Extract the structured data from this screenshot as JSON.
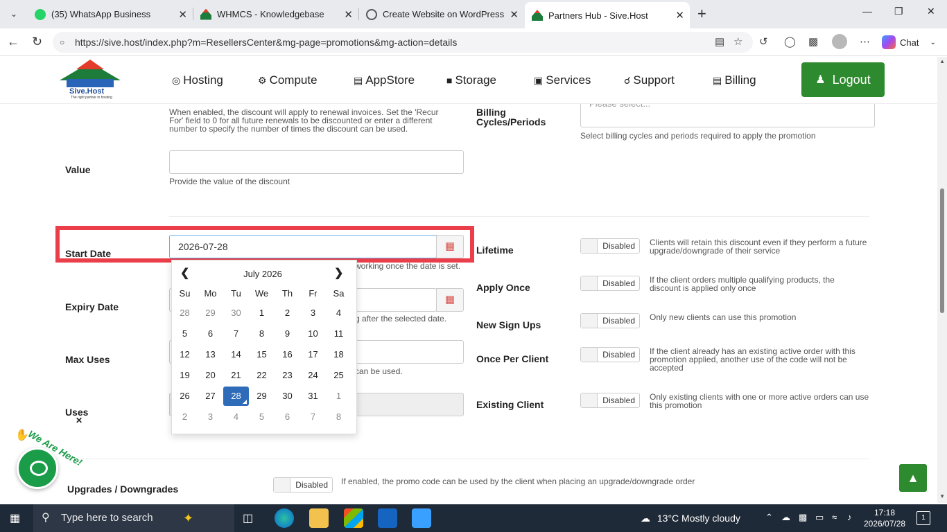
{
  "browser": {
    "tabs": [
      {
        "label": "(35) WhatsApp Business"
      },
      {
        "label": "WHMCS - Knowledgebase"
      },
      {
        "label": "Create Website on WordPress"
      },
      {
        "label": "Partners Hub - Sive.Host"
      }
    ],
    "url": "https://sive.host/index.php?m=ResellersCenter&mg-page=promotions&mg-action=details",
    "chat_label": "Chat"
  },
  "site": {
    "logo_text": "Sive.Host",
    "logo_tagline": "The right partner in hosting",
    "menu": [
      {
        "label": "Hosting",
        "icon": "globe-icon"
      },
      {
        "label": "Compute",
        "icon": "gear-icon"
      },
      {
        "label": "AppStore",
        "icon": "database-icon"
      },
      {
        "label": "Storage",
        "icon": "box-icon"
      },
      {
        "label": "Services",
        "icon": "gift-icon"
      },
      {
        "label": "Support",
        "icon": "headset-icon"
      },
      {
        "label": "Billing",
        "icon": "document-icon"
      }
    ],
    "logout_label": "Logout"
  },
  "form": {
    "recurring_help": "When enabled, the discount will apply to renewal invoices. Set the 'Recur For' field to 0 for all future renewals to be discounted or enter a different number to specify the number of times the discount can be used.",
    "billing_cycles_label": "Billing Cycles/Periods",
    "billing_cycles_placeholder": "Please select...",
    "billing_cycles_help": "Select billing cycles and periods required to apply the promotion",
    "value_label": "Value",
    "value_value": "",
    "value_help": "Provide the value of the discount",
    "start_date_label": "Start Date",
    "start_date_value": "2026-07-28",
    "start_date_help_tail": "working once the date is set.",
    "expiry_date_label": "Expiry Date",
    "expiry_help_tail": "g after the selected date.",
    "max_uses_label": "Max Uses",
    "max_uses_help_tail": "can be used.",
    "uses_label": "Uses",
    "upgrades_label": "Upgrades / Downgrades",
    "upgrades_help": "If enabled, the promo code can be used by the client when placing an upgrade/downgrade order",
    "toggles": [
      {
        "label": "Lifetime",
        "state": "Disabled",
        "help": "Clients will retain this discount even if they perform a future upgrade/downgrade of their service"
      },
      {
        "label": "Apply Once",
        "state": "Disabled",
        "help": "If the client orders multiple qualifying products, the discount is applied only once"
      },
      {
        "label": "New Sign Ups",
        "state": "Disabled",
        "help": "Only new clients can use this promotion"
      },
      {
        "label": "Once Per Client",
        "state": "Disabled",
        "help": "If the client already has an existing active order with this promotion applied, another use of the code will not be accepted"
      },
      {
        "label": "Existing Client",
        "state": "Disabled",
        "help": "Only existing clients with one or more active orders can use this promotion"
      }
    ],
    "upgrades_state": "Disabled"
  },
  "datepicker": {
    "title": "July 2026",
    "weekdays": [
      "Su",
      "Mo",
      "Tu",
      "We",
      "Th",
      "Fr",
      "Sa"
    ],
    "weeks": [
      [
        "28",
        "29",
        "30",
        "1",
        "2",
        "3",
        "4"
      ],
      [
        "5",
        "6",
        "7",
        "8",
        "9",
        "10",
        "11"
      ],
      [
        "12",
        "13",
        "14",
        "15",
        "16",
        "17",
        "18"
      ],
      [
        "19",
        "20",
        "21",
        "22",
        "23",
        "24",
        "25"
      ],
      [
        "26",
        "27",
        "28",
        "29",
        "30",
        "31",
        "1"
      ],
      [
        "2",
        "3",
        "4",
        "5",
        "6",
        "7",
        "8"
      ]
    ],
    "selected": "28"
  },
  "chat_widget": {
    "text": "We Are Here!"
  },
  "taskbar": {
    "search_placeholder": "Type here to search",
    "weather": "13°C  Mostly cloudy",
    "time": "17:18",
    "date": "2026/07/28",
    "notifications": "1"
  }
}
